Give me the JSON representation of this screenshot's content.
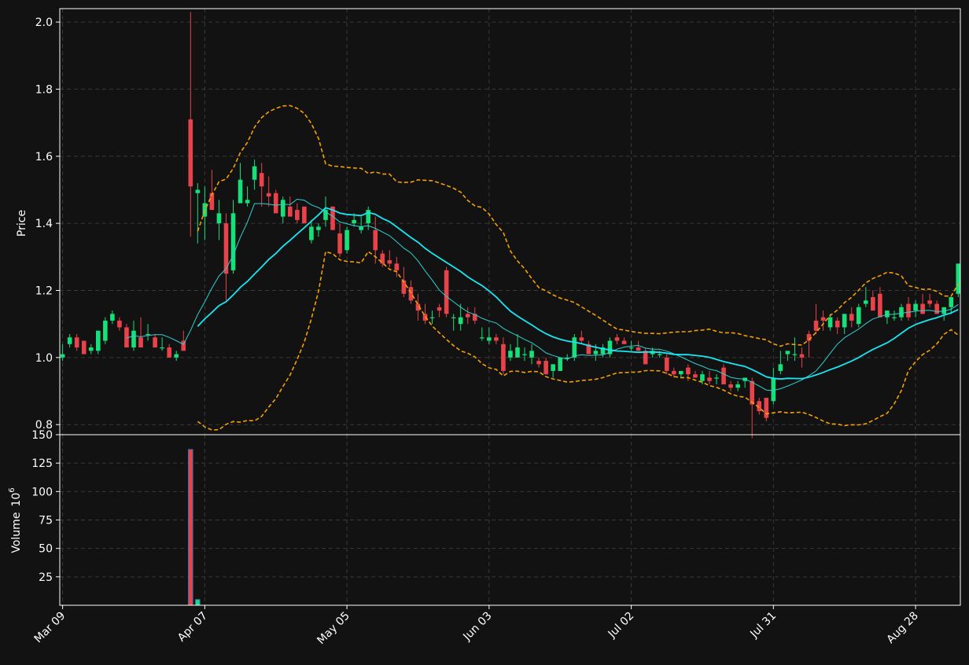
{
  "chart_data": {
    "type": "candlestick",
    "colors": {
      "background": "#121212",
      "up": "#16e07a",
      "down": "#e8434a",
      "sma_fast": "#2fd0d0",
      "sma_slow": "#19e6f2",
      "bands": "#f5a000",
      "grid": "#3a3a3a",
      "axis": "#ffffff"
    },
    "price_axis": {
      "label": "Price",
      "ylim": [
        0.77,
        2.04
      ],
      "ticks": [
        "0.8",
        "1.0",
        "1.2",
        "1.4",
        "1.6",
        "1.8",
        "2.0"
      ]
    },
    "volume_axis": {
      "label": "Volume",
      "exponent": "6",
      "ylim": [
        0,
        150
      ],
      "ticks": [
        "25",
        "50",
        "75",
        "100",
        "125",
        "150"
      ]
    },
    "x_ticks": [
      {
        "index": 0,
        "label": "Mar 09"
      },
      {
        "index": 20,
        "label": "Apr 07"
      },
      {
        "index": 40,
        "label": "May 05"
      },
      {
        "index": 60,
        "label": "Jun 03"
      },
      {
        "index": 80,
        "label": "Jul 02"
      },
      {
        "index": 100,
        "label": "Jul 31"
      },
      {
        "index": 120,
        "label": "Aug 28"
      }
    ],
    "x_range": [
      -0.4,
      126.3
    ],
    "grid": true,
    "ohlc": [
      [
        1.0,
        1.04,
        0.99,
        1.01
      ],
      [
        1.04,
        1.07,
        1.03,
        1.06
      ],
      [
        1.06,
        1.07,
        1.02,
        1.03
      ],
      [
        1.05,
        1.05,
        1.01,
        1.01
      ],
      [
        1.02,
        1.04,
        1.01,
        1.03
      ],
      [
        1.02,
        1.08,
        1.01,
        1.08
      ],
      [
        1.05,
        1.12,
        1.04,
        1.11
      ],
      [
        1.11,
        1.14,
        1.1,
        1.13
      ],
      [
        1.11,
        1.12,
        1.08,
        1.09
      ],
      [
        1.09,
        1.1,
        1.03,
        1.03
      ],
      [
        1.03,
        1.11,
        1.02,
        1.08
      ],
      [
        1.06,
        1.12,
        1.03,
        1.03
      ],
      [
        1.07,
        1.1,
        1.05,
        1.07
      ],
      [
        1.06,
        1.07,
        1.03,
        1.03
      ],
      [
        1.03,
        1.06,
        1.02,
        1.03
      ],
      [
        1.03,
        1.04,
        1.0,
        1.0
      ],
      [
        1.0,
        1.02,
        0.99,
        1.01
      ],
      [
        1.05,
        1.08,
        1.02,
        1.02
      ],
      [
        1.71,
        2.03,
        1.36,
        1.51
      ],
      [
        1.49,
        1.52,
        1.34,
        1.5
      ],
      [
        1.42,
        1.51,
        1.35,
        1.46
      ],
      [
        1.49,
        1.56,
        1.44,
        1.44
      ],
      [
        1.4,
        1.47,
        1.35,
        1.43
      ],
      [
        1.4,
        1.43,
        1.17,
        1.25
      ],
      [
        1.26,
        1.47,
        1.25,
        1.43
      ],
      [
        1.46,
        1.58,
        1.46,
        1.53
      ],
      [
        1.46,
        1.51,
        1.45,
        1.47
      ],
      [
        1.53,
        1.59,
        1.5,
        1.57
      ],
      [
        1.55,
        1.58,
        1.45,
        1.51
      ],
      [
        1.49,
        1.54,
        1.45,
        1.48
      ],
      [
        1.49,
        1.5,
        1.43,
        1.43
      ],
      [
        1.42,
        1.48,
        1.4,
        1.47
      ],
      [
        1.45,
        1.48,
        1.42,
        1.42
      ],
      [
        1.44,
        1.46,
        1.4,
        1.41
      ],
      [
        1.45,
        1.45,
        1.41,
        1.4
      ],
      [
        1.35,
        1.41,
        1.34,
        1.39
      ],
      [
        1.38,
        1.4,
        1.36,
        1.39
      ],
      [
        1.41,
        1.48,
        1.39,
        1.44
      ],
      [
        1.45,
        1.45,
        1.39,
        1.38
      ],
      [
        1.37,
        1.4,
        1.3,
        1.31
      ],
      [
        1.32,
        1.39,
        1.31,
        1.38
      ],
      [
        1.4,
        1.43,
        1.39,
        1.41
      ],
      [
        1.38,
        1.42,
        1.37,
        1.39
      ],
      [
        1.4,
        1.45,
        1.38,
        1.44
      ],
      [
        1.38,
        1.42,
        1.28,
        1.32
      ],
      [
        1.31,
        1.32,
        1.27,
        1.28
      ],
      [
        1.29,
        1.32,
        1.27,
        1.28
      ],
      [
        1.28,
        1.3,
        1.24,
        1.26
      ],
      [
        1.23,
        1.27,
        1.18,
        1.19
      ],
      [
        1.21,
        1.23,
        1.16,
        1.17
      ],
      [
        1.16,
        1.19,
        1.11,
        1.14
      ],
      [
        1.13,
        1.16,
        1.1,
        1.11
      ],
      [
        1.12,
        1.14,
        1.1,
        1.12
      ],
      [
        1.15,
        1.16,
        1.12,
        1.14
      ],
      [
        1.26,
        1.27,
        1.12,
        1.13
      ],
      [
        1.12,
        1.13,
        1.08,
        1.12
      ],
      [
        1.1,
        1.16,
        1.08,
        1.12
      ],
      [
        1.13,
        1.15,
        1.1,
        1.12
      ],
      [
        1.13,
        1.15,
        1.1,
        1.11
      ],
      [
        1.06,
        1.09,
        1.05,
        1.06
      ],
      [
        1.05,
        1.09,
        1.04,
        1.06
      ],
      [
        1.06,
        1.07,
        1.04,
        1.05
      ],
      [
        1.04,
        1.06,
        0.95,
        0.96
      ],
      [
        1.0,
        1.04,
        0.99,
        1.02
      ],
      [
        1.0,
        1.07,
        1.0,
        1.03
      ],
      [
        1.01,
        1.03,
        0.99,
        1.01
      ],
      [
        1.0,
        1.04,
        0.98,
        1.02
      ],
      [
        0.99,
        1.0,
        0.97,
        0.98
      ],
      [
        0.99,
        1.0,
        0.95,
        0.95
      ],
      [
        0.96,
        0.98,
        0.94,
        0.98
      ],
      [
        0.96,
        1.0,
        0.96,
        1.0
      ],
      [
        1.0,
        1.01,
        0.99,
        1.0
      ],
      [
        1.0,
        1.07,
        0.99,
        1.06
      ],
      [
        1.06,
        1.08,
        1.04,
        1.05
      ],
      [
        1.04,
        1.05,
        1.01,
        1.01
      ],
      [
        1.01,
        1.04,
        0.99,
        1.02
      ],
      [
        1.01,
        1.04,
        1.0,
        1.03
      ],
      [
        1.01,
        1.06,
        1.0,
        1.05
      ],
      [
        1.06,
        1.07,
        1.04,
        1.05
      ],
      [
        1.05,
        1.06,
        1.04,
        1.04
      ],
      [
        1.03,
        1.05,
        1.02,
        1.03
      ],
      [
        1.03,
        1.05,
        1.02,
        1.02
      ],
      [
        1.02,
        1.03,
        0.98,
        0.98
      ],
      [
        1.01,
        1.03,
        1.0,
        1.02
      ],
      [
        1.01,
        1.02,
        1.0,
        1.01
      ],
      [
        1.0,
        1.01,
        0.95,
        0.96
      ],
      [
        0.96,
        0.97,
        0.94,
        0.95
      ],
      [
        0.95,
        0.96,
        0.94,
        0.96
      ],
      [
        0.97,
        0.98,
        0.93,
        0.95
      ],
      [
        0.95,
        0.96,
        0.94,
        0.94
      ],
      [
        0.93,
        0.96,
        0.92,
        0.95
      ],
      [
        0.94,
        0.96,
        0.92,
        0.93
      ],
      [
        0.94,
        0.95,
        0.92,
        0.94
      ],
      [
        0.97,
        0.98,
        0.92,
        0.92
      ],
      [
        0.92,
        0.93,
        0.9,
        0.91
      ],
      [
        0.91,
        0.93,
        0.9,
        0.92
      ],
      [
        0.93,
        0.94,
        0.91,
        0.94
      ],
      [
        0.93,
        0.94,
        0.76,
        0.86
      ],
      [
        0.87,
        0.88,
        0.83,
        0.84
      ],
      [
        0.88,
        0.88,
        0.81,
        0.82
      ],
      [
        0.87,
        0.97,
        0.86,
        0.94
      ],
      [
        0.96,
        1.02,
        0.95,
        0.98
      ],
      [
        1.01,
        1.02,
        0.99,
        1.02
      ],
      [
        1.01,
        1.06,
        0.99,
        1.01
      ],
      [
        1.01,
        1.03,
        0.97,
        1.0
      ],
      [
        1.07,
        1.08,
        1.0,
        1.05
      ],
      [
        1.11,
        1.16,
        1.07,
        1.08
      ],
      [
        1.12,
        1.14,
        1.08,
        1.11
      ],
      [
        1.09,
        1.13,
        1.08,
        1.12
      ],
      [
        1.11,
        1.12,
        1.07,
        1.09
      ],
      [
        1.09,
        1.13,
        1.07,
        1.13
      ],
      [
        1.13,
        1.15,
        1.09,
        1.11
      ],
      [
        1.1,
        1.16,
        1.09,
        1.15
      ],
      [
        1.16,
        1.21,
        1.15,
        1.17
      ],
      [
        1.18,
        1.2,
        1.14,
        1.14
      ],
      [
        1.19,
        1.21,
        1.12,
        1.12
      ],
      [
        1.12,
        1.14,
        1.1,
        1.14
      ],
      [
        1.12,
        1.14,
        1.11,
        1.12
      ],
      [
        1.12,
        1.16,
        1.11,
        1.15
      ],
      [
        1.16,
        1.18,
        1.11,
        1.12
      ],
      [
        1.14,
        1.17,
        1.12,
        1.16
      ],
      [
        1.16,
        1.19,
        1.13,
        1.13
      ],
      [
        1.17,
        1.19,
        1.15,
        1.16
      ],
      [
        1.16,
        1.17,
        1.14,
        1.13
      ],
      [
        1.13,
        1.15,
        1.11,
        1.15
      ],
      [
        1.15,
        1.18,
        1.13,
        1.18
      ],
      [
        1.19,
        1.28,
        1.18,
        1.28
      ]
    ],
    "volume_spikes": [
      {
        "index": 18,
        "value": 137
      },
      {
        "index": 19,
        "value": 5
      }
    ],
    "volume_baseline": 0.3
  }
}
